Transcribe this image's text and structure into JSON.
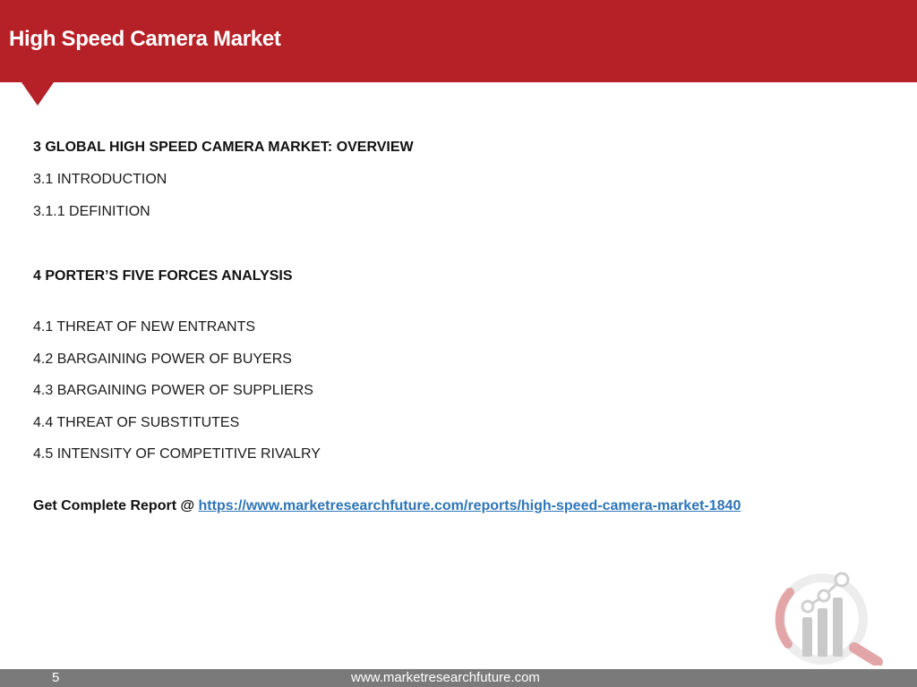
{
  "header": {
    "title": "High Speed Camera Market"
  },
  "contents": {
    "section3": {
      "heading": "3 GLOBAL HIGH SPEED CAMERA MARKET: OVERVIEW",
      "items": [
        "3.1 INTRODUCTION",
        "3.1.1 DEFINITION"
      ]
    },
    "section4": {
      "heading": "4 PORTER’S FIVE FORCES ANALYSIS",
      "items": [
        "4.1 THREAT OF NEW ENTRANTS",
        "4.2 BARGAINING POWER OF BUYERS",
        "4.3 BARGAINING POWER OF SUPPLIERS",
        "4.4 THREAT OF SUBSTITUTES",
        "4.5 INTENSITY OF COMPETITIVE RIVALRY"
      ]
    }
  },
  "cta": {
    "label": "Get Complete Report @ ",
    "url": "https://www.marketresearchfuture.com/reports/high-speed-camera-market-1840"
  },
  "footer": {
    "page_number": "5",
    "website": "www.marketresearchfuture.com"
  },
  "colors": {
    "header_red": "#b52126",
    "link_blue": "#2e75b6",
    "footer_gray": "#7a7a7a"
  },
  "icons": {
    "logo": "magnifier-bar-chart-logo-icon"
  }
}
